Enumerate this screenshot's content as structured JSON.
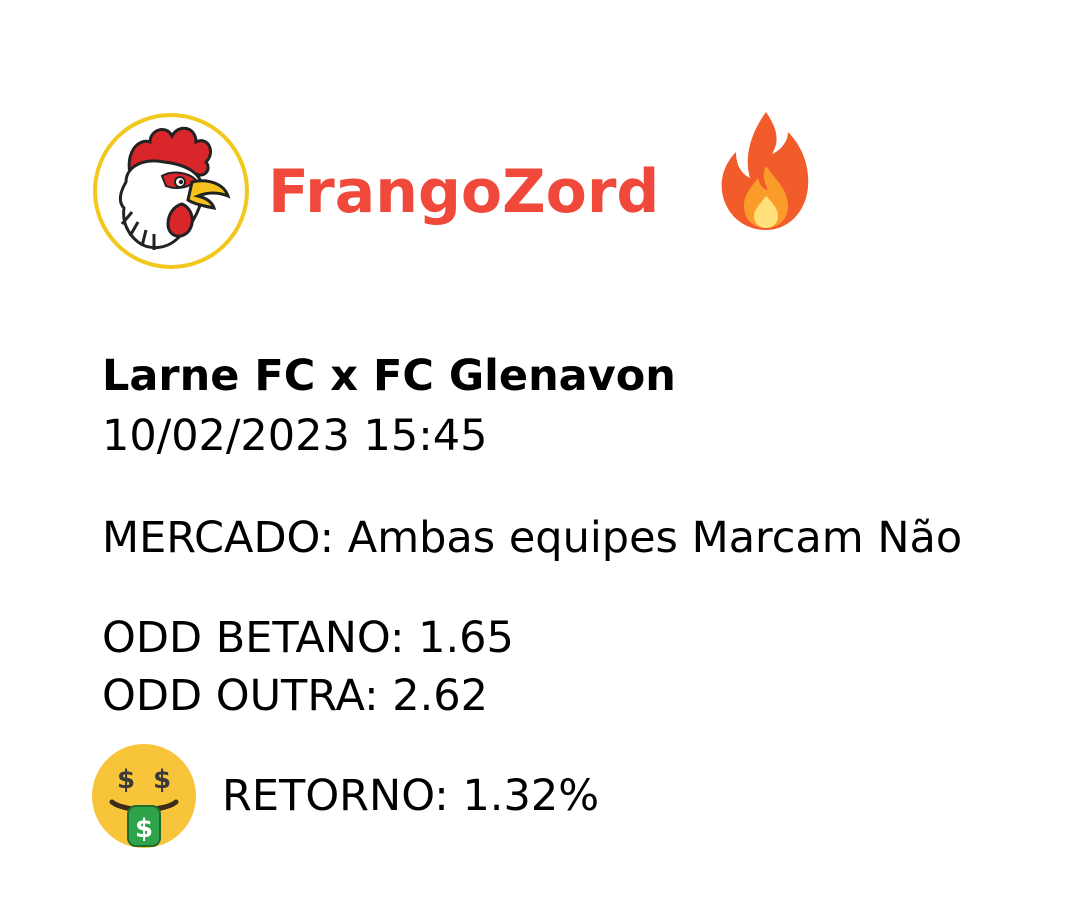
{
  "brand": {
    "name": "FrangoZord",
    "logo_icon": "rooster-logo-icon",
    "accent_color": "#f0483a",
    "badge_icon": "fire-icon"
  },
  "match": {
    "title": "Larne FC x FC Glenavon",
    "datetime": "10/02/2023 15:45"
  },
  "market": {
    "text": "MERCADO: Ambas equipes Marcam Não"
  },
  "odds": {
    "betano": "ODD BETANO: 1.65",
    "outra": "ODD OUTRA: 2.62"
  },
  "return": {
    "icon": "money-mouth-face-icon",
    "text": "RETORNO: 1.32%"
  }
}
